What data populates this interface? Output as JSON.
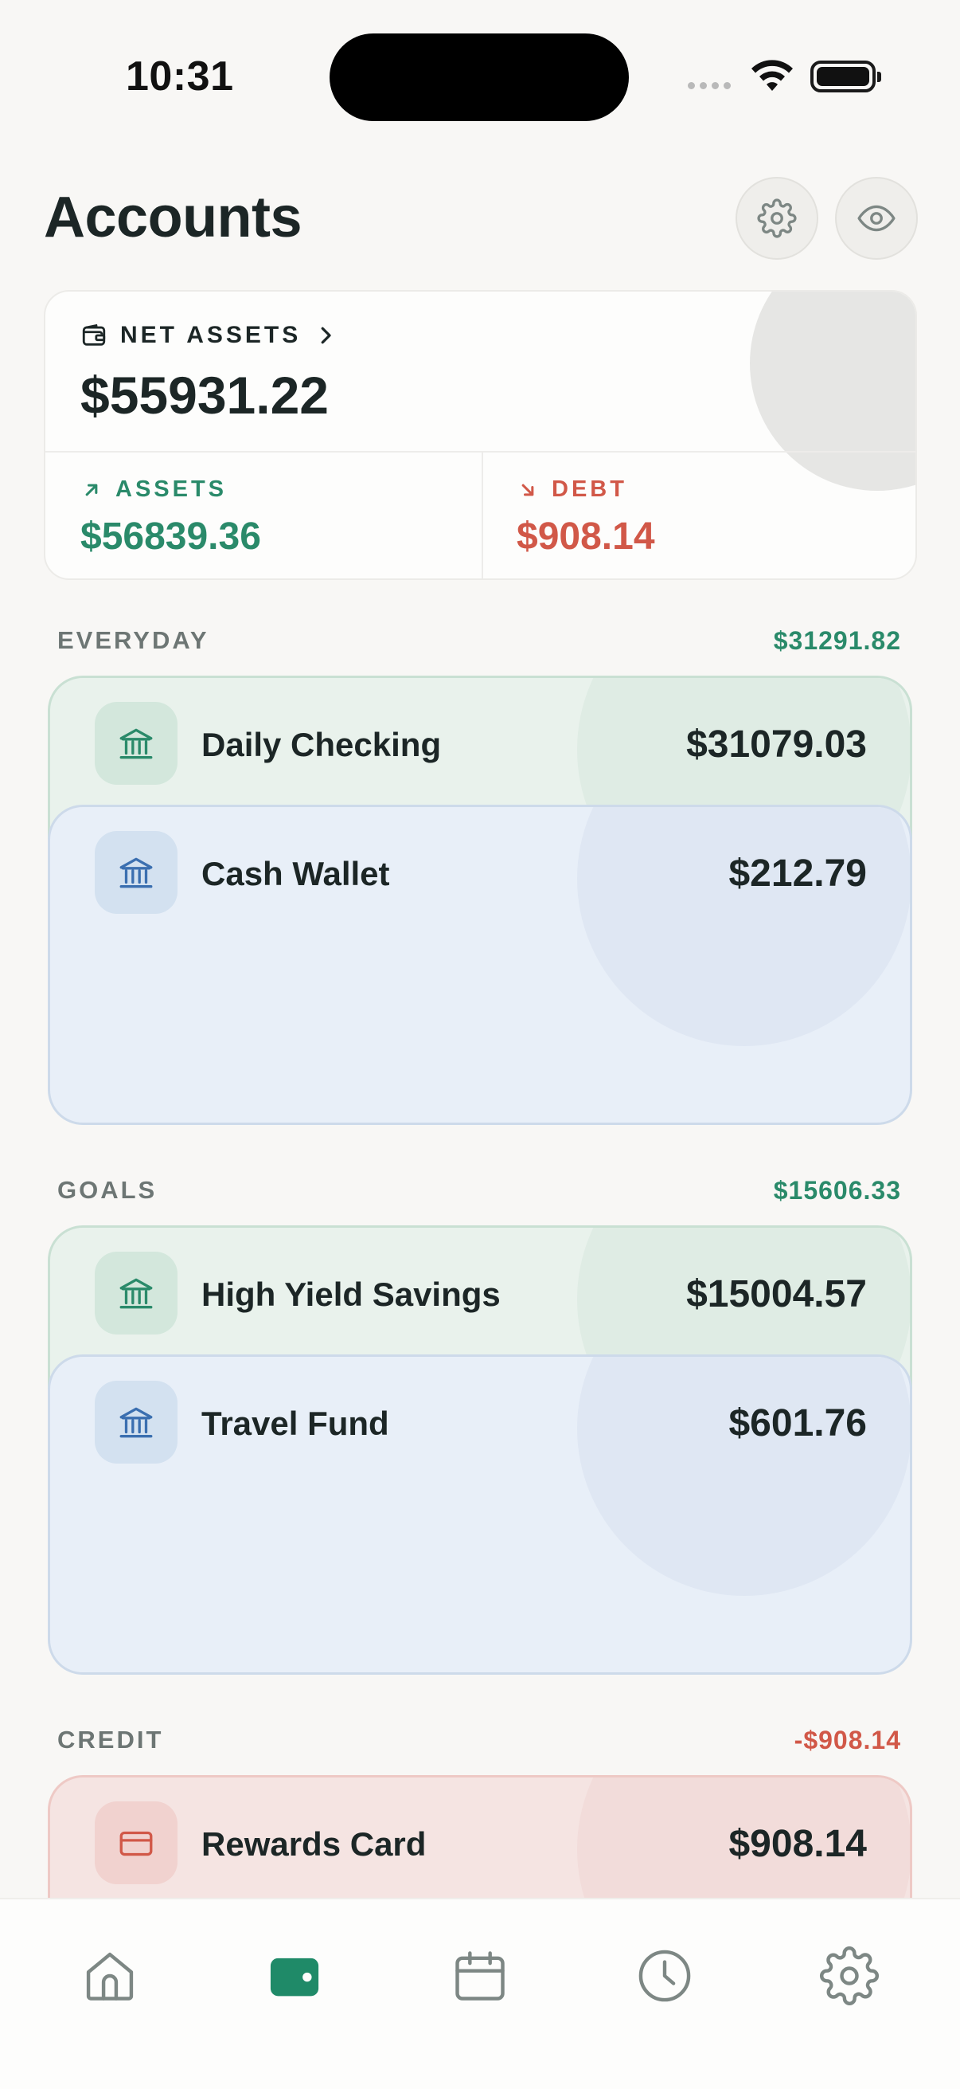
{
  "status": {
    "time": "10:31"
  },
  "header": {
    "title": "Accounts"
  },
  "summary": {
    "net_label": "NET ASSETS",
    "net_value": "$55931.22",
    "assets_label": "ASSETS",
    "assets_value": "$56839.36",
    "debt_label": "DEBT",
    "debt_value": "$908.14"
  },
  "sections": [
    {
      "title": "EVERYDAY",
      "total": "$31291.82",
      "accounts": [
        {
          "name": "Daily Checking",
          "amount": "$31079.03",
          "icon": "bank-icon"
        },
        {
          "name": "Cash Wallet",
          "amount": "$212.79",
          "icon": "bank-icon"
        }
      ]
    },
    {
      "title": "GOALS",
      "total": "$15606.33",
      "accounts": [
        {
          "name": "High Yield Savings",
          "amount": "$15004.57",
          "icon": "bank-icon"
        },
        {
          "name": "Travel Fund",
          "amount": "$601.76",
          "icon": "bank-icon"
        }
      ]
    },
    {
      "title": "CREDIT",
      "total": "-$908.14",
      "accounts": [
        {
          "name": "Rewards Card",
          "amount": "$908.14",
          "icon": "credit-card-icon"
        }
      ]
    }
  ],
  "tabs": [
    {
      "icon": "home-icon",
      "active": false
    },
    {
      "icon": "wallet-icon",
      "active": true
    },
    {
      "icon": "calendar-icon",
      "active": false
    },
    {
      "icon": "clock-icon",
      "active": false
    },
    {
      "icon": "gear-icon",
      "active": false
    }
  ],
  "colors": {
    "positive": "#2a8a6a",
    "negative": "#d15848",
    "background": "#f8f7f5",
    "active_tab": "#1f8a68",
    "inactive_tab": "#7d8784"
  }
}
